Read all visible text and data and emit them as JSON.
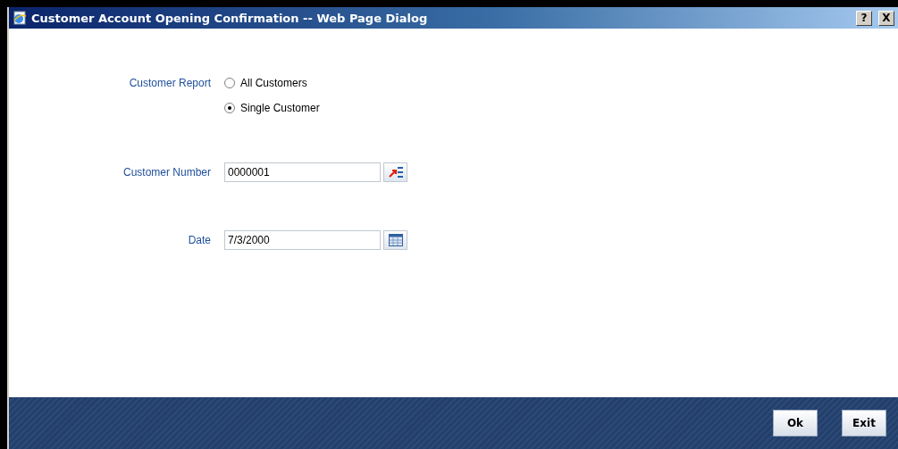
{
  "window": {
    "title": "Customer Account Opening Confirmation -- Web Page Dialog",
    "title_buttons": [
      "?",
      "X"
    ]
  },
  "customer_report": {
    "label": "Customer Report",
    "options": [
      {
        "label": "All Customers",
        "selected": false
      },
      {
        "label": "Single Customer",
        "selected": true
      }
    ]
  },
  "fields": [
    {
      "kind": "lookup",
      "label": "Customer Number",
      "value": "0000001"
    },
    {
      "kind": "date",
      "label": "Date",
      "value": "7/3/2000"
    }
  ],
  "buttons": [
    "Ok",
    "Exit"
  ]
}
